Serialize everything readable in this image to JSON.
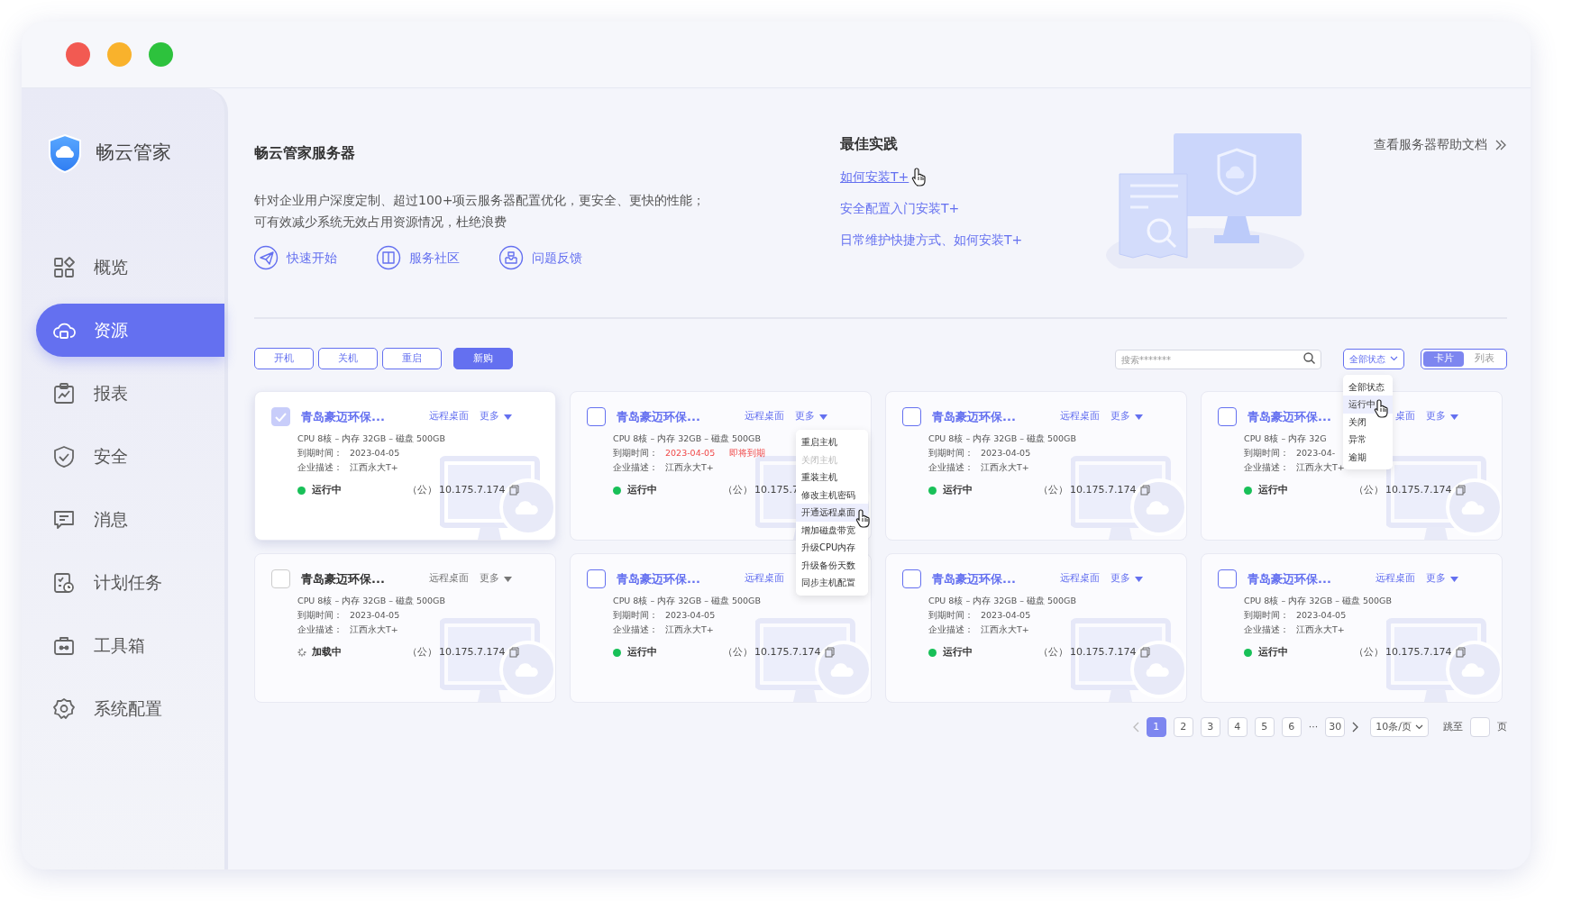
{
  "window": {
    "controls": [
      {
        "color": "#f25a52"
      },
      {
        "color": "#f9b22c"
      },
      {
        "color": "#2dc23d"
      }
    ]
  },
  "sidebar": {
    "brand": "畅云管家",
    "items": [
      {
        "label": "概览",
        "selected": false
      },
      {
        "label": "资源",
        "selected": true
      },
      {
        "label": "报表",
        "selected": false
      },
      {
        "label": "安全",
        "selected": false
      },
      {
        "label": "消息",
        "selected": false
      },
      {
        "label": "计划任务",
        "selected": false
      },
      {
        "label": "工具箱",
        "selected": false
      },
      {
        "label": "系统配置",
        "selected": false
      }
    ]
  },
  "intro": {
    "title": "畅云管家服务器",
    "description": [
      "针对企业用户深度定制、超过100+项云服务器配置优化，更安全、更快的性能；",
      "可有效减少系统无效占用资源情况，杜绝浪费"
    ],
    "links": [
      "快速开始",
      "服务社区",
      "问题反馈"
    ]
  },
  "best_practice": {
    "title": "最佳实践",
    "links": [
      {
        "text": "如何安装T+",
        "hovered": true
      },
      {
        "text": "安全配置入门安装T+",
        "hovered": false
      },
      {
        "text": "日常维护快捷方式、如何安装T+",
        "hovered": false
      }
    ]
  },
  "help_link": "查看服务器帮助文档",
  "toolbar": {
    "buttons": [
      {
        "label": "开机",
        "primary": false
      },
      {
        "label": "关机",
        "primary": false
      },
      {
        "label": "重启",
        "primary": false
      },
      {
        "label": "新购",
        "primary": true
      }
    ],
    "search": {
      "placeholder": "搜索*******"
    },
    "status_filter": {
      "value": "全部状态",
      "options": [
        {
          "label": "全部状态",
          "hovered": false
        },
        {
          "label": "运行中",
          "hovered": true
        },
        {
          "label": "关闭",
          "hovered": false
        },
        {
          "label": "异常",
          "hovered": false
        },
        {
          "label": "逾期",
          "hovered": false
        }
      ]
    },
    "view_toggle": [
      {
        "label": "卡片",
        "selected": true
      },
      {
        "label": "列表",
        "selected": false
      }
    ]
  },
  "servers": [
    {
      "checked": true,
      "disabled": false,
      "title": "青岛豪迈环保...",
      "remote": "远程桌面",
      "more": "更多",
      "specs": "CPU 8核 – 内存 32GB – 磁盘 500GB",
      "expiry_label": "到期时间：",
      "expiry": "2023-04-05",
      "expiring": false,
      "desc_label": "企业描述：",
      "desc": "江西永大T+",
      "status": "运行中",
      "loading": false,
      "ip_label": "（公）",
      "ip": "10.175.7.174"
    },
    {
      "checked": false,
      "disabled": false,
      "title": "青岛豪迈环保...",
      "remote": "远程桌面",
      "more": "更多",
      "specs": "CPU 8核 – 内存 32GB – 磁盘 500GB",
      "expiry_label": "到期时间：",
      "expiry": "2023-04-05",
      "expiring": true,
      "warning": "即将到期",
      "desc_label": "企业描述：",
      "desc": "江西永大T+",
      "status": "运行中",
      "loading": false,
      "ip_label": "（公）",
      "ip": "10.175.7",
      "menu": [
        {
          "label": "重启主机",
          "disabled": false,
          "hovered": false
        },
        {
          "label": "关闭主机",
          "disabled": true,
          "hovered": false
        },
        {
          "label": "重装主机",
          "disabled": false,
          "hovered": false
        },
        {
          "label": "修改主机密码",
          "disabled": false,
          "hovered": false
        },
        {
          "label": "开通远程桌面",
          "disabled": false,
          "hovered": true
        },
        {
          "label": "增加磁盘带宽",
          "disabled": false,
          "hovered": false
        },
        {
          "label": "升级CPU内存",
          "disabled": false,
          "hovered": false
        },
        {
          "label": "升级备份天数",
          "disabled": false,
          "hovered": false
        },
        {
          "label": "同步主机配置",
          "disabled": false,
          "hovered": false
        }
      ]
    },
    {
      "checked": false,
      "disabled": false,
      "title": "青岛豪迈环保...",
      "remote": "远程桌面",
      "more": "更多",
      "specs": "CPU 8核 – 内存 32GB – 磁盘 500GB",
      "expiry_label": "到期时间：",
      "expiry": "2023-04-05",
      "expiring": false,
      "desc_label": "企业描述：",
      "desc": "江西永大T+",
      "status": "运行中",
      "loading": false,
      "ip_label": "（公）",
      "ip": "10.175.7.174"
    },
    {
      "checked": false,
      "disabled": false,
      "title": "青岛豪迈环保...",
      "remote": "桌面",
      "more": "更多",
      "specs": "CPU 8核 – 内存 32G",
      "expiry_label": "到期时间：",
      "expiry": "2023-04-",
      "expiring": false,
      "desc_label": "企业描述：",
      "desc": "江西永大T+",
      "status": "运行中",
      "loading": false,
      "ip_label": "（公）",
      "ip": "10.175.7.174"
    },
    {
      "checked": false,
      "disabled": true,
      "title": "青岛豪迈环保...",
      "remote": "远程桌面",
      "more": "更多",
      "specs": "CPU 8核 – 内存 32GB – 磁盘 500GB",
      "expiry_label": "到期时间：",
      "expiry": "2023-04-05",
      "expiring": false,
      "desc_label": "企业描述：",
      "desc": "江西永大T+",
      "status": "加载中",
      "loading": true,
      "ip_label": "（公）",
      "ip": "10.175.7.174"
    },
    {
      "checked": false,
      "disabled": false,
      "title": "青岛豪迈环保...",
      "remote": "远程桌面",
      "specs": "CPU 8核 – 内存 32GB – 磁盘 500GB",
      "expiry_label": "到期时间：",
      "expiry": "2023-04-05",
      "expiring": false,
      "desc_label": "企业描述：",
      "desc": "江西永大T+",
      "status": "运行中",
      "loading": false,
      "ip_label": "（公）",
      "ip": "10.175.7.174"
    },
    {
      "checked": false,
      "disabled": false,
      "title": "青岛豪迈环保...",
      "remote": "远程桌面",
      "more": "更多",
      "specs": "CPU 8核 – 内存 32GB – 磁盘 500GB",
      "expiry_label": "到期时间：",
      "expiry": "2023-04-05",
      "expiring": false,
      "desc_label": "企业描述：",
      "desc": "江西永大T+",
      "status": "运行中",
      "loading": false,
      "ip_label": "（公）",
      "ip": "10.175.7.174"
    },
    {
      "checked": false,
      "disabled": false,
      "title": "青岛豪迈环保...",
      "remote": "远程桌面",
      "more": "更多",
      "specs": "CPU 8核 – 内存 32GB – 磁盘 500GB",
      "expiry_label": "到期时间：",
      "expiry": "2023-04-05",
      "expiring": false,
      "desc_label": "企业描述：",
      "desc": "江西永大T+",
      "status": "运行中",
      "loading": false,
      "ip_label": "（公）",
      "ip": "10.175.7.174"
    }
  ],
  "pagination": {
    "pages": [
      {
        "label": "1",
        "kind": "page",
        "selected": true
      },
      {
        "label": "2",
        "kind": "page",
        "selected": false
      },
      {
        "label": "3",
        "kind": "page",
        "selected": false
      },
      {
        "label": "4",
        "kind": "page",
        "selected": false
      },
      {
        "label": "5",
        "kind": "page",
        "selected": false
      },
      {
        "label": "6",
        "kind": "page",
        "selected": false
      },
      {
        "label": "···",
        "kind": "ellipsis"
      },
      {
        "label": "30",
        "kind": "page",
        "selected": false
      }
    ],
    "page_size": "10条/页",
    "jump_label": "跳至",
    "page_unit": "页"
  }
}
